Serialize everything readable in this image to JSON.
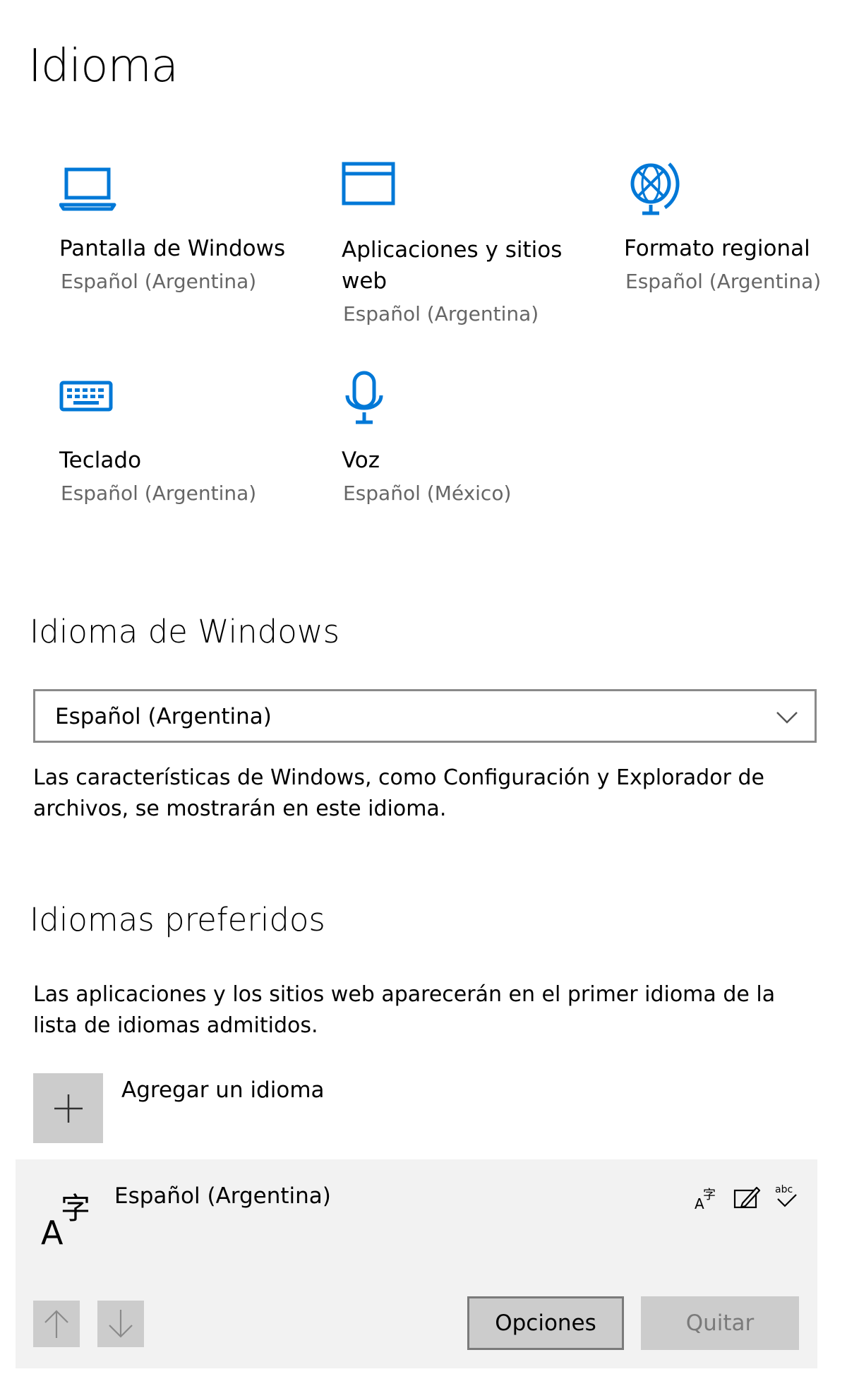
{
  "page": {
    "title": "Idioma"
  },
  "tiles": [
    {
      "title_lines": [
        "Pantalla de Windows"
      ],
      "subtitle": "Español (Argentina)",
      "icon": "laptop-icon"
    },
    {
      "title_lines": [
        "Aplicaciones y sitios",
        "web"
      ],
      "subtitle": "Español (Argentina)",
      "icon": "window-icon"
    },
    {
      "title_lines": [
        "Formato regional"
      ],
      "subtitle": "Español (Argentina)",
      "icon": "globe-icon"
    },
    {
      "title_lines": [
        "Teclado"
      ],
      "subtitle": "Español (Argentina)",
      "icon": "keyboard-icon"
    },
    {
      "title_lines": [
        "Voz"
      ],
      "subtitle": "Español (México)",
      "icon": "microphone-icon"
    }
  ],
  "windows_language": {
    "heading": "Idioma de Windows",
    "selected": "Español (Argentina)",
    "description_lines": [
      "Las características de Windows, como Configuración y Explorador de",
      "archivos, se mostrarán en este idioma."
    ]
  },
  "preferred_languages": {
    "heading": "Idiomas preferidos",
    "description_lines": [
      "Las aplicaciones y los sitios web aparecerán en el primer idioma de la",
      "lista de idiomas admitidos."
    ],
    "add_label": "Agregar un idioma",
    "items": [
      {
        "name": "Español (Argentina)",
        "features": [
          "display-language-icon",
          "handwriting-icon",
          "spellcheck-icon"
        ],
        "options_label": "Opciones",
        "remove_label": "Quitar"
      }
    ]
  },
  "colors": {
    "accent": "#0078d7",
    "subtle_text": "#666666",
    "panel_bg": "#f2f2f2",
    "button_bg": "#cccccc"
  }
}
